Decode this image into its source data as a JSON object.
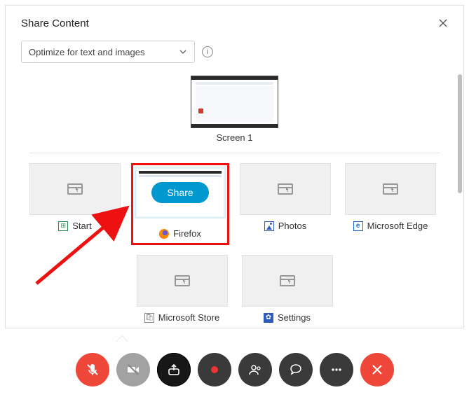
{
  "dialog": {
    "title": "Share Content",
    "dropdown": {
      "selected": "Optimize for text and images"
    },
    "screen": {
      "label": "Screen 1"
    },
    "apps": [
      {
        "name": "Start",
        "icon": "start-icon"
      },
      {
        "name": "Firefox",
        "icon": "firefox-icon",
        "selected": true,
        "share_label": "Share"
      },
      {
        "name": "Photos",
        "icon": "photos-icon"
      },
      {
        "name": "Microsoft Edge",
        "icon": "edge-icon"
      },
      {
        "name": "Microsoft Store",
        "icon": "store-icon"
      },
      {
        "name": "Settings",
        "icon": "settings-icon"
      }
    ]
  },
  "toolbar": {
    "buttons": [
      "mute",
      "video",
      "share",
      "record",
      "participants",
      "chat",
      "more",
      "leave"
    ]
  },
  "colors": {
    "accent": "#0098cf",
    "danger": "#ee4638",
    "highlight": "#e11"
  }
}
